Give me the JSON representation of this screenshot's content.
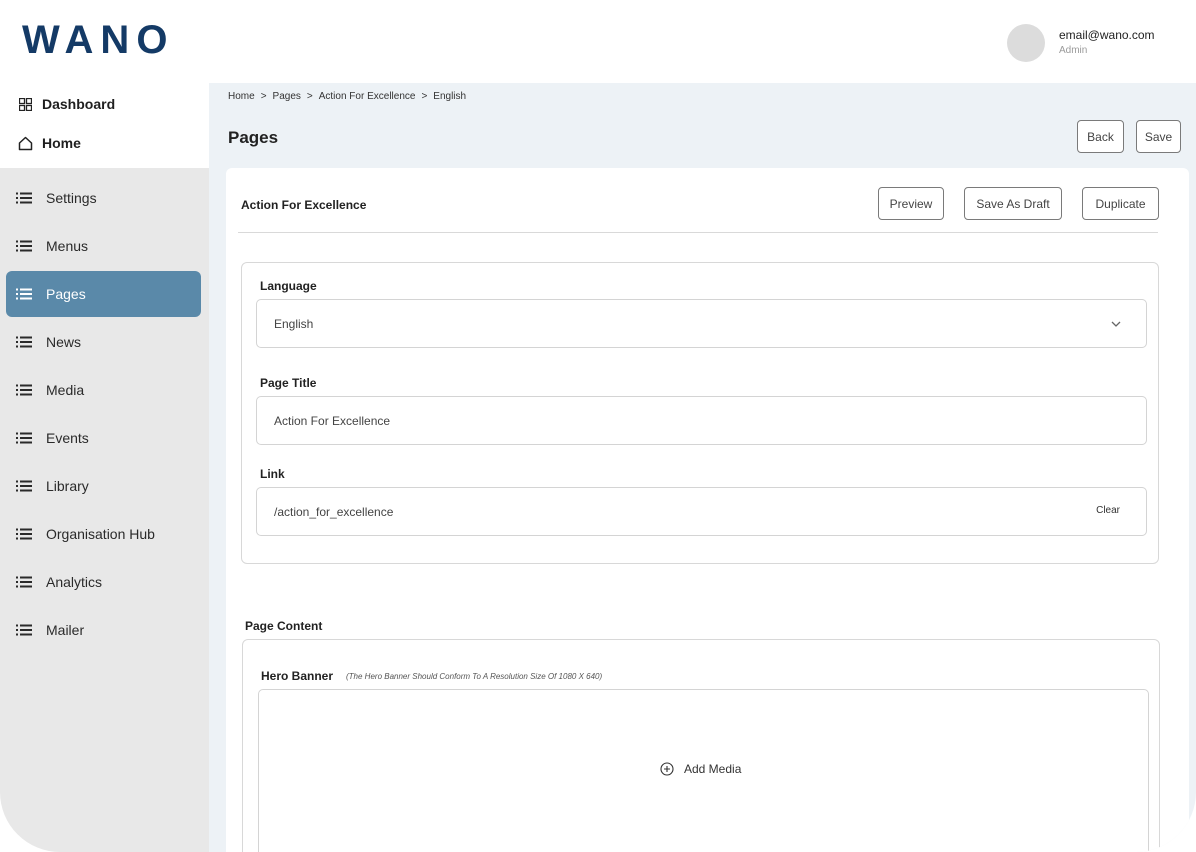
{
  "brand": {
    "logo": "WANO"
  },
  "user": {
    "email": "email@wano.com",
    "role": "Admin"
  },
  "sidebar": {
    "top_items": [
      {
        "label": "Dashboard",
        "icon": "grid-icon"
      },
      {
        "label": "Home",
        "icon": "home-icon"
      }
    ],
    "items": [
      {
        "label": "Settings",
        "icon": "list-icon",
        "active": false
      },
      {
        "label": "Menus",
        "icon": "list-icon",
        "active": false
      },
      {
        "label": "Pages",
        "icon": "list-icon",
        "active": true
      },
      {
        "label": "News",
        "icon": "list-icon",
        "active": false
      },
      {
        "label": "Media",
        "icon": "list-icon",
        "active": false
      },
      {
        "label": "Events",
        "icon": "list-icon",
        "active": false
      },
      {
        "label": "Library",
        "icon": "list-icon",
        "active": false
      },
      {
        "label": "Organisation Hub",
        "icon": "list-icon",
        "active": false
      },
      {
        "label": "Analytics",
        "icon": "list-icon",
        "active": false
      },
      {
        "label": "Mailer",
        "icon": "list-icon",
        "active": false
      }
    ]
  },
  "breadcrumb": {
    "items": [
      "Home",
      "Pages",
      "Action For Excellence",
      "English"
    ],
    "separator": ">"
  },
  "page": {
    "title": "Pages",
    "back_label": "Back",
    "save_label": "Save"
  },
  "card": {
    "title": "Action For Excellence",
    "preview_label": "Preview",
    "save_draft_label": "Save As Draft",
    "duplicate_label": "Duplicate"
  },
  "form": {
    "language": {
      "label": "Language",
      "value": "English"
    },
    "page_title": {
      "label": "Page Title",
      "value": "Action For Excellence"
    },
    "link": {
      "label": "Link",
      "value": "/action_for_excellence",
      "clear_label": "Clear"
    }
  },
  "content": {
    "section_label": "Page Content",
    "hero_label": "Hero Banner",
    "hero_hint": "(The Hero Banner Should Conform To A Resolution Size Of 1080 X 640)",
    "add_media_label": "Add Media"
  },
  "colors": {
    "brand": "#143a66",
    "active_nav": "#5a89a9",
    "main_bg": "#edf2f6",
    "sidebar_bg": "#e8e8e8"
  }
}
